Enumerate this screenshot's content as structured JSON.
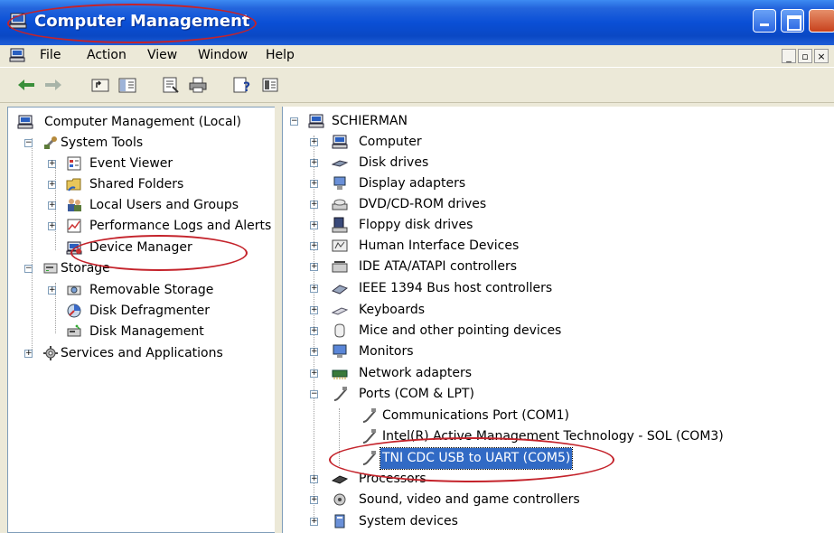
{
  "window": {
    "title": "Computer Management",
    "controls": {
      "minimize": "_",
      "maximize": "□",
      "close": "×"
    },
    "mdi_controls": [
      "_",
      "▫",
      "×"
    ]
  },
  "menu": [
    "File",
    "Action",
    "View",
    "Window",
    "Help"
  ],
  "toolbar": [
    "back-arrow-icon",
    "forward-arrow-icon",
    "up-folder-icon",
    "show-tree-icon",
    "properties-icon",
    "print-icon",
    "help-icon",
    "console-icon"
  ],
  "left_tree": {
    "root": "Computer Management (Local)",
    "system_tools": {
      "label": "System Tools",
      "items": [
        "Event Viewer",
        "Shared Folders",
        "Local Users and Groups",
        "Performance Logs and Alerts",
        "Device Manager"
      ]
    },
    "storage": {
      "label": "Storage",
      "items": [
        "Removable Storage",
        "Disk Defragmenter",
        "Disk Management"
      ]
    },
    "services": "Services and Applications"
  },
  "right_tree": {
    "root": "SCHIERMAN",
    "categories": [
      "Computer",
      "Disk drives",
      "Display adapters",
      "DVD/CD-ROM drives",
      "Floppy disk drives",
      "Human Interface Devices",
      "IDE ATA/ATAPI controllers",
      "IEEE 1394 Bus host controllers",
      "Keyboards",
      "Mice and other pointing devices",
      "Monitors",
      "Network adapters"
    ],
    "ports": {
      "label": "Ports (COM & LPT)",
      "items": [
        "Communications Port (COM1)",
        "Intel(R) Active Management Technology - SOL (COM3)",
        "TNI CDC USB to UART (COM5)"
      ]
    },
    "after": [
      "Processors",
      "Sound, video and game controllers",
      "System devices"
    ]
  },
  "colors": {
    "title_blue": "#0a4fd6",
    "selection": "#316ac5",
    "annotation": "#c4232b"
  }
}
